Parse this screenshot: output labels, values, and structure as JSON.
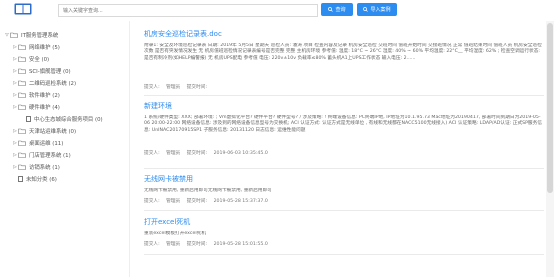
{
  "header": {
    "search_placeholder": "输入关键字查询...",
    "query_label": "查询",
    "import_label": "导入案例"
  },
  "sidebar": {
    "root": {
      "label": "IT服务管理系统",
      "expanded": true
    },
    "items": [
      {
        "label": "网络维护 (5)",
        "kind": "folder"
      },
      {
        "label": "安全 (0)",
        "kind": "folder"
      },
      {
        "label": "SCI-旗舰管理 (0)",
        "kind": "folder"
      },
      {
        "label": "二维码巡检系统 (2)",
        "kind": "folder"
      },
      {
        "label": "软件维护 (2)",
        "kind": "folder"
      },
      {
        "label": "硬件维护 (4)",
        "kind": "folder",
        "expanded": true
      },
      {
        "label": "中心生态城综合服务项目 (0)",
        "kind": "file"
      },
      {
        "label": "天津站运维系统 (0)",
        "kind": "folder"
      },
      {
        "label": "桌面运维 (11)",
        "kind": "folder"
      },
      {
        "label": "门店管理系统 (1)",
        "kind": "folder"
      },
      {
        "label": "访销系统 (1)",
        "kind": "folder"
      },
      {
        "label": "未知分类 (6)",
        "kind": "file"
      }
    ]
  },
  "articles": [
    {
      "title": "机房安全巡检记录表.doc",
      "body": "附录1: 安全及环境巡检记录表 日期: 2019年 5月5日 星期天 巡检人员: 潘涛 项目 检查内容及记录 机房安全巡检 交班时间 值班开始时间 交接班情况 正常 值班结束时间 值班人员 机房安全巡检次数 是否有突发情况发生 无 机房值班巡检情况记录表编号是否完整 完整 主机房环境 参考值: 温度: 18°C ~ 26°C 湿度: 40% ~ 60% 平均温度: 22°C__ 平均湿度: 62% ; 检查空调运行状态: 是否有制冷剂(如HELP编警报) 无 机房UPS配电 参考值 电压: 220v±10v 负载率≤80% 蓄头机A1上UPS工作状态 输入电压: 2......",
      "submitter_label": "提交人:",
      "submitter": "管理员",
      "time_label": "提交时间:",
      "time": ""
    },
    {
      "title": "新建环境",
      "body": "1 系统/硬件类型: XXX; 部署环境: ; Vm虚拟化平台? 硬件平台? 硬件型号? / 涉及策略: ! 终端设备信息: PC终端IP地, IP地址为10.1.95.73 Mac地址为20190417, 部署时间到期日为2019-05-06 20:00-22:00 网络设备信息: 涉及到的网络设备信息型号为交换机; ACI 认证方式: 认证方式是无线单位 , 有线和无线都在NACC5100无线接入) ACI 认证策略: LDAP/AD认证: 正式SP服务信息: UnINAC20170915SP1 子服务信息: 20131120 日志信息: 运维性能问题",
      "submitter_label": "提交人:",
      "submitter": "管理员",
      "time_label": "提交时间:",
      "time": "2019-06-03 10:35:45.0"
    },
    {
      "title": "无线网卡被禁用",
      "body": "无线网卡被禁用, 重新启用即可无线网卡被禁用, 重新启用即可",
      "submitter_label": "提交人:",
      "submitter": "管理员",
      "time_label": "提交时间:",
      "time": "2019-05-28 15:37:37.0"
    },
    {
      "title": "打开excel死机",
      "body": "重装excel模板打开excel死机",
      "submitter_label": "提交人:",
      "submitter": "管理员",
      "time_label": "提交时间:",
      "time": "2019-05-28 15:01:55.0"
    }
  ],
  "colors": {
    "accent": "#2d8cf0",
    "link": "#2d8cf0",
    "folder": "#f6c343"
  }
}
